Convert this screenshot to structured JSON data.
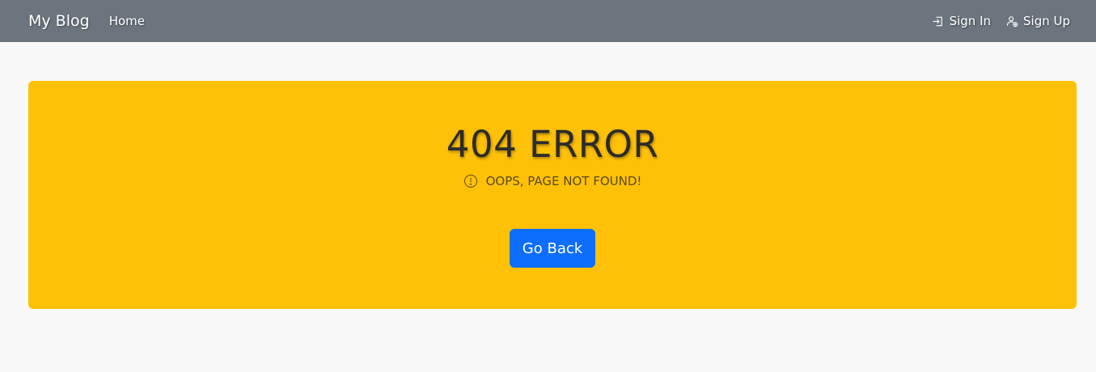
{
  "navbar": {
    "brand": "My Blog",
    "home_label": "Home",
    "sign_in_label": "Sign In",
    "sign_up_label": "Sign Up",
    "background_color": "#6c757d"
  },
  "error": {
    "title": "404 ERROR",
    "subtitle": "OOPS, PAGE NOT FOUND!",
    "icon": "exclamation-circle-icon",
    "background_color": "#ffc107",
    "button_label": "Go Back",
    "button_color": "#0d6efd"
  },
  "icons": {
    "sign_in": "sign-in-icon",
    "sign_up": "add-user-icon"
  }
}
